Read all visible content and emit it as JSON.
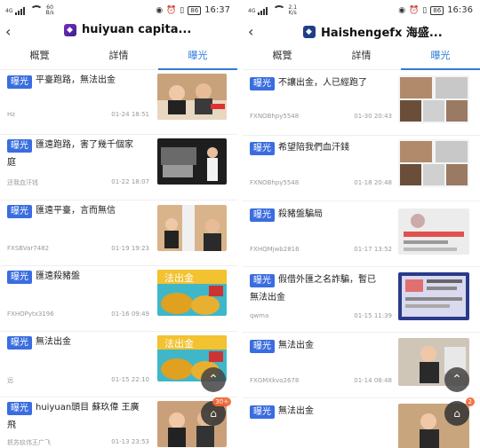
{
  "left": {
    "status": {
      "net": "4G",
      "speed_top": "60",
      "speed_bottom": "B/s",
      "battery": "86",
      "time": "16:37"
    },
    "title": "huiyuan capita...",
    "tabs": [
      "概覽",
      "詳情",
      "曝光"
    ],
    "badge": "曝光",
    "items": [
      {
        "text": "平臺跑路，無法出金",
        "user": "Hz",
        "date": "01-24 18:51"
      },
      {
        "text": "匯遠跑路，害了幾千個家庭",
        "user": "还我血汗钱",
        "date": "01-22 18:07"
      },
      {
        "text": "匯遠平臺，言而無信",
        "user": "FXSBVar7482",
        "date": "01-19 19:23"
      },
      {
        "text": "匯遠殺豬盤",
        "user": "FXHOPytx3196",
        "date": "01-16 09:49"
      },
      {
        "text": "無法出金",
        "user": "远",
        "date": "01-15 22:10"
      },
      {
        "text": "huiyuan頭目 蘇玖偉 王廣飛",
        "user": "抓苏玖伟王广飞",
        "date": "01-13 23:53"
      }
    ],
    "thumb_labels": [
      "法出金",
      "法出金"
    ],
    "fab_up": "⌃",
    "fab_count": "30+"
  },
  "right": {
    "status": {
      "net": "4G",
      "speed_top": "2.1",
      "speed_bottom": "K/s",
      "battery": "86",
      "time": "16:36"
    },
    "title": "Haishengefx 海盛...",
    "tabs": [
      "概覽",
      "詳情",
      "曝光"
    ],
    "badge": "曝光",
    "items": [
      {
        "text": "不讓出金，人已經跑了",
        "user": "FXNOBhpy5548",
        "date": "01-30 20:43"
      },
      {
        "text": "希望陪我們血汗錢",
        "user": "FXNOBhpy5548",
        "date": "01-18 20:48"
      },
      {
        "text": "殺豬盤騙局",
        "user": "FXHQMjwb2816",
        "date": "01-17 13:52"
      },
      {
        "text": "假借外匯之名詐騙，暫已無法出金",
        "user": "qwma",
        "date": "01-15 11:39"
      },
      {
        "text": "無法出金",
        "user": "FXGMXkvo2678",
        "date": "01-14 08:48"
      },
      {
        "text": "無法出金",
        "user": "",
        "date": ""
      }
    ],
    "fab_up": "⌃",
    "fab_count": "2"
  }
}
